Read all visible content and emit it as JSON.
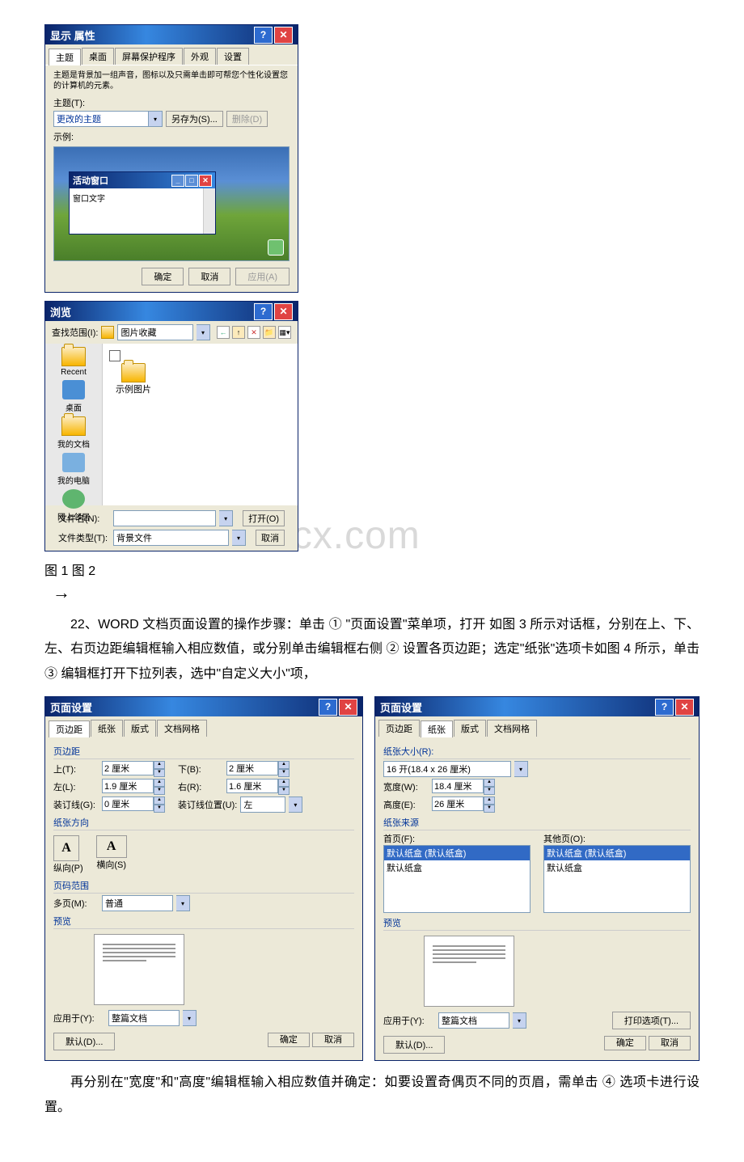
{
  "dialog1": {
    "title": "显示 属性",
    "tabs": [
      "主题",
      "桌面",
      "屏幕保护程序",
      "外观",
      "设置"
    ],
    "note": "主题是背景加一组声音，图标以及只需单击即可帮您个性化设置您的计算机的元素。",
    "theme_label": "主题(T):",
    "theme_value": "更改的主题",
    "save_as": "另存为(S)...",
    "delete": "删除(D)",
    "sample_label": "示例:",
    "mini_title": "活动窗口",
    "mini_text": "窗口文字",
    "ok": "确定",
    "cancel": "取消",
    "apply": "应用(A)"
  },
  "dialog2": {
    "title": "浏览",
    "lookin_label": "查找范围(I):",
    "lookin_value": "图片收藏",
    "places": [
      "Recent",
      "桌面",
      "我的文档",
      "我的电脑",
      "网上邻居"
    ],
    "folder_label": "示例图片",
    "filename_label": "文件名(N):",
    "filetype_label": "文件类型(T):",
    "filetype_value": "背景文件",
    "open": "打开(O)",
    "cancel": "取消"
  },
  "caption12": "图 1         图 2",
  "para22": "22、WORD 文档页面设置的操作步骤：单击 ①  \"页面设置\"菜单项，打开 如图 3 所示对话框，分别在上、下、左、右页边距编辑框输入相应数值，或分别单击编辑框右侧 ② 设置各页边距；选定\"纸张\"选项卡如图 4 所示，单击③ 编辑框打开下拉列表，选中\"自定义大小\"项，",
  "ps1": {
    "title": "页面设置",
    "tabs": [
      "页边距",
      "纸张",
      "版式",
      "文档网格"
    ],
    "group_margin": "页边距",
    "top_l": "上(T):",
    "top_v": "2 厘米",
    "bot_l": "下(B):",
    "bot_v": "2 厘米",
    "left_l": "左(L):",
    "left_v": "1.9 厘米",
    "right_l": "右(R):",
    "right_v": "1.6 厘米",
    "gut_l": "装订线(G):",
    "gut_v": "0 厘米",
    "gutpos_l": "装订线位置(U):",
    "gutpos_v": "左",
    "group_orient": "纸张方向",
    "portrait": "纵向(P)",
    "landscape": "横向(S)",
    "group_pages": "页码范围",
    "multi_l": "多页(M):",
    "multi_v": "普通",
    "preview": "预览",
    "apply_l": "应用于(Y):",
    "apply_v": "整篇文档",
    "default": "默认(D)...",
    "ok": "确定",
    "cancel": "取消"
  },
  "ps2": {
    "title": "页面设置",
    "tabs": [
      "页边距",
      "纸张",
      "版式",
      "文档网格"
    ],
    "group_size": "纸张大小(R):",
    "size_v": "16 开(18.4 x 26 厘米)",
    "width_l": "宽度(W):",
    "width_v": "18.4 厘米",
    "height_l": "高度(E):",
    "height_v": "26 厘米",
    "group_source": "纸张来源",
    "first_l": "首页(F):",
    "other_l": "其他页(O):",
    "tray_sel": "默认纸盒 (默认纸盒)",
    "tray_item": "默认纸盒",
    "preview": "预览",
    "apply_l": "应用于(Y):",
    "apply_v": "整篇文档",
    "printopt": "打印选项(T)...",
    "default": "默认(D)...",
    "ok": "确定",
    "cancel": "取消"
  },
  "para_end": "再分别在\"宽度\"和\"高度\"编辑框输入相应数值并确定：如要设置奇偶页不同的页眉，需单击 ④ 选项卡进行设置。"
}
